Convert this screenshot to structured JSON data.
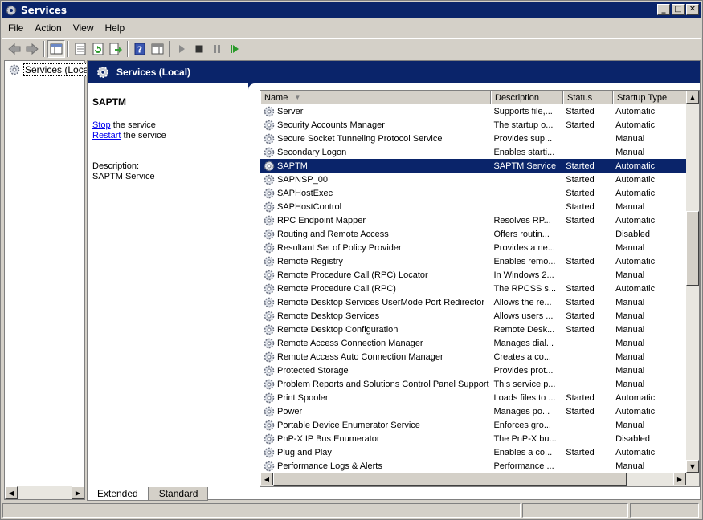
{
  "window": {
    "title": "Services"
  },
  "menu": [
    "File",
    "Action",
    "View",
    "Help"
  ],
  "tree": {
    "root_label": "Services (Local)"
  },
  "header": {
    "title": "Services (Local)"
  },
  "detail": {
    "service_name": "SAPTM",
    "stop_link": "Stop",
    "stop_rest": " the service",
    "restart_link": "Restart",
    "restart_rest": " the service",
    "description_label": "Description:",
    "description_text": "SAPTM Service"
  },
  "table": {
    "columns": [
      "Name",
      "Description",
      "Status",
      "Startup Type"
    ],
    "selected_index": 4,
    "rows": [
      {
        "name": "Server",
        "description": "Supports file,...",
        "status": "Started",
        "startup": "Automatic"
      },
      {
        "name": "Security Accounts Manager",
        "description": "The startup o...",
        "status": "Started",
        "startup": "Automatic"
      },
      {
        "name": "Secure Socket Tunneling Protocol Service",
        "description": "Provides sup...",
        "status": "",
        "startup": "Manual"
      },
      {
        "name": "Secondary Logon",
        "description": "Enables starti...",
        "status": "",
        "startup": "Manual"
      },
      {
        "name": "SAPTM",
        "description": "SAPTM Service",
        "status": "Started",
        "startup": "Automatic"
      },
      {
        "name": "SAPNSP_00",
        "description": "",
        "status": "Started",
        "startup": "Automatic"
      },
      {
        "name": "SAPHostExec",
        "description": "",
        "status": "Started",
        "startup": "Automatic"
      },
      {
        "name": "SAPHostControl",
        "description": "",
        "status": "Started",
        "startup": "Manual"
      },
      {
        "name": "RPC Endpoint Mapper",
        "description": "Resolves RP...",
        "status": "Started",
        "startup": "Automatic"
      },
      {
        "name": "Routing and Remote Access",
        "description": "Offers routin...",
        "status": "",
        "startup": "Disabled"
      },
      {
        "name": "Resultant Set of Policy Provider",
        "description": "Provides a ne...",
        "status": "",
        "startup": "Manual"
      },
      {
        "name": "Remote Registry",
        "description": "Enables remo...",
        "status": "Started",
        "startup": "Automatic"
      },
      {
        "name": "Remote Procedure Call (RPC) Locator",
        "description": "In Windows 2...",
        "status": "",
        "startup": "Manual"
      },
      {
        "name": "Remote Procedure Call (RPC)",
        "description": "The RPCSS s...",
        "status": "Started",
        "startup": "Automatic"
      },
      {
        "name": "Remote Desktop Services UserMode Port Redirector",
        "description": "Allows the re...",
        "status": "Started",
        "startup": "Manual"
      },
      {
        "name": "Remote Desktop Services",
        "description": "Allows users ...",
        "status": "Started",
        "startup": "Manual"
      },
      {
        "name": "Remote Desktop Configuration",
        "description": "Remote Desk...",
        "status": "Started",
        "startup": "Manual"
      },
      {
        "name": "Remote Access Connection Manager",
        "description": "Manages dial...",
        "status": "",
        "startup": "Manual"
      },
      {
        "name": "Remote Access Auto Connection Manager",
        "description": "Creates a co...",
        "status": "",
        "startup": "Manual"
      },
      {
        "name": "Protected Storage",
        "description": "Provides prot...",
        "status": "",
        "startup": "Manual"
      },
      {
        "name": "Problem Reports and Solutions Control Panel Support",
        "description": "This service p...",
        "status": "",
        "startup": "Manual"
      },
      {
        "name": "Print Spooler",
        "description": "Loads files to ...",
        "status": "Started",
        "startup": "Automatic"
      },
      {
        "name": "Power",
        "description": "Manages po...",
        "status": "Started",
        "startup": "Automatic"
      },
      {
        "name": "Portable Device Enumerator Service",
        "description": "Enforces gro...",
        "status": "",
        "startup": "Manual"
      },
      {
        "name": "PnP-X IP Bus Enumerator",
        "description": "The PnP-X bu...",
        "status": "",
        "startup": "Disabled"
      },
      {
        "name": "Plug and Play",
        "description": "Enables a co...",
        "status": "Started",
        "startup": "Automatic"
      },
      {
        "name": "Performance Logs & Alerts",
        "description": "Performance ...",
        "status": "",
        "startup": "Manual"
      }
    ]
  },
  "tabs": [
    "Extended",
    "Standard"
  ],
  "colors": {
    "title_bar": "#0a246a",
    "selection": "#0a246a",
    "face": "#d4d0c8"
  },
  "icons": {
    "toolbar": [
      "back-arrow-icon",
      "forward-arrow-icon",
      "show-hide-tree-icon",
      "properties-icon",
      "refresh-icon",
      "export-list-icon",
      "help-icon",
      "console-pane-icon",
      "start-service-icon",
      "stop-service-icon",
      "pause-service-icon",
      "restart-service-icon"
    ],
    "service": "gear-icon"
  }
}
